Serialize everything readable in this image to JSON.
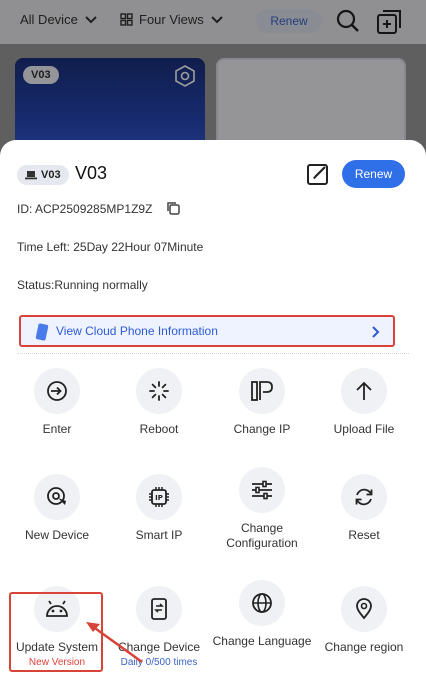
{
  "topbar": {
    "device_filter": "All Device",
    "view_mode": "Four Views",
    "renew_label": "Renew"
  },
  "background_cards": [
    {
      "chip": "V03"
    }
  ],
  "sheet": {
    "device_chip": "V03",
    "device_name": "V03",
    "renew_label": "Renew",
    "id_text": "ID: ACP2509285MP1Z9Z",
    "time_left": "Time Left: 25Day 22Hour 07Minute",
    "status": "Status:Running normally",
    "cloud_info_label": "View Cloud Phone Information"
  },
  "actions": [
    {
      "label": "Enter",
      "icon": "enter-icon"
    },
    {
      "label": "Reboot",
      "icon": "reboot-icon"
    },
    {
      "label": "Change IP",
      "icon": "ip-icon"
    },
    {
      "label": "Upload File",
      "icon": "upload-icon"
    },
    {
      "label": "New Device",
      "icon": "new-device-icon"
    },
    {
      "label": "Smart IP",
      "icon": "chip-icon"
    },
    {
      "label": "Change Configuration",
      "icon": "sliders-icon"
    },
    {
      "label": "Reset",
      "icon": "reset-icon"
    },
    {
      "label": "Update System",
      "sub": "New Version",
      "icon": "android-icon"
    },
    {
      "label": "Change Device",
      "sub": "Daily 0/500 times",
      "icon": "phone-swap-icon"
    },
    {
      "label": "Change Language",
      "icon": "globe-icon"
    },
    {
      "label": "Change region",
      "icon": "location-icon"
    }
  ],
  "colors": {
    "accent": "#2f6fe8",
    "highlight": "#d8443a",
    "link": "#2e5bd4"
  }
}
